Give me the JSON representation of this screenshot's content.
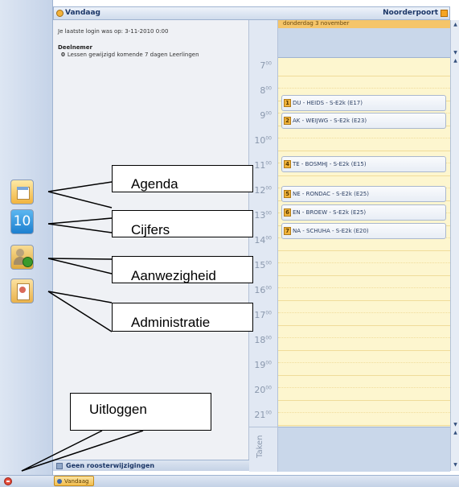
{
  "header": {
    "title": "Vandaag",
    "org": "Noorderpoort"
  },
  "info": {
    "login": "Je laatste login was op: 3-11-2010 0:00",
    "section": "Deelnemer",
    "lesson_count": "0",
    "lesson_text": "Lessen gewijzigd komende 7 dagen Leerlingen"
  },
  "footer_panel": {
    "label": "Geen roosterwijzigingen"
  },
  "calendar": {
    "day": "donderdag 3 november",
    "hours": [
      "7",
      "8",
      "9",
      "10",
      "11",
      "12",
      "13",
      "14",
      "15",
      "16",
      "17",
      "18",
      "19",
      "20",
      "21"
    ],
    "minutes": "00",
    "tasks_label": "Taken",
    "lessons": [
      {
        "n": "1",
        "text": "DU - HEIDS - S-E2k  (E17)"
      },
      {
        "n": "2",
        "text": "AK - WEIJWG - S-E2k  (E23)"
      },
      {
        "n": "4",
        "text": "TE - BOSMHJ - S-E2k  (E15)"
      },
      {
        "n": "5",
        "text": "NE - RONDAC - S-E2k  (E25)"
      },
      {
        "n": "6",
        "text": "EN - BROEW - S-E2k  (E25)"
      },
      {
        "n": "7",
        "text": "NA - SCHUHA - S-E2k  (E20)"
      }
    ]
  },
  "taskbar": {
    "button": "Vandaag"
  },
  "callouts": {
    "agenda": "Agenda",
    "cijfers": "Cijfers",
    "aanwezigheid": "Aanwezigheid",
    "administratie": "Administratie",
    "uitloggen": "Uitloggen"
  },
  "icons": {
    "cijfers_number": "10"
  },
  "colors": {
    "accent": "#f5c56a",
    "day_bg": "#fdf6cf",
    "rail": "#c5d3e8"
  }
}
